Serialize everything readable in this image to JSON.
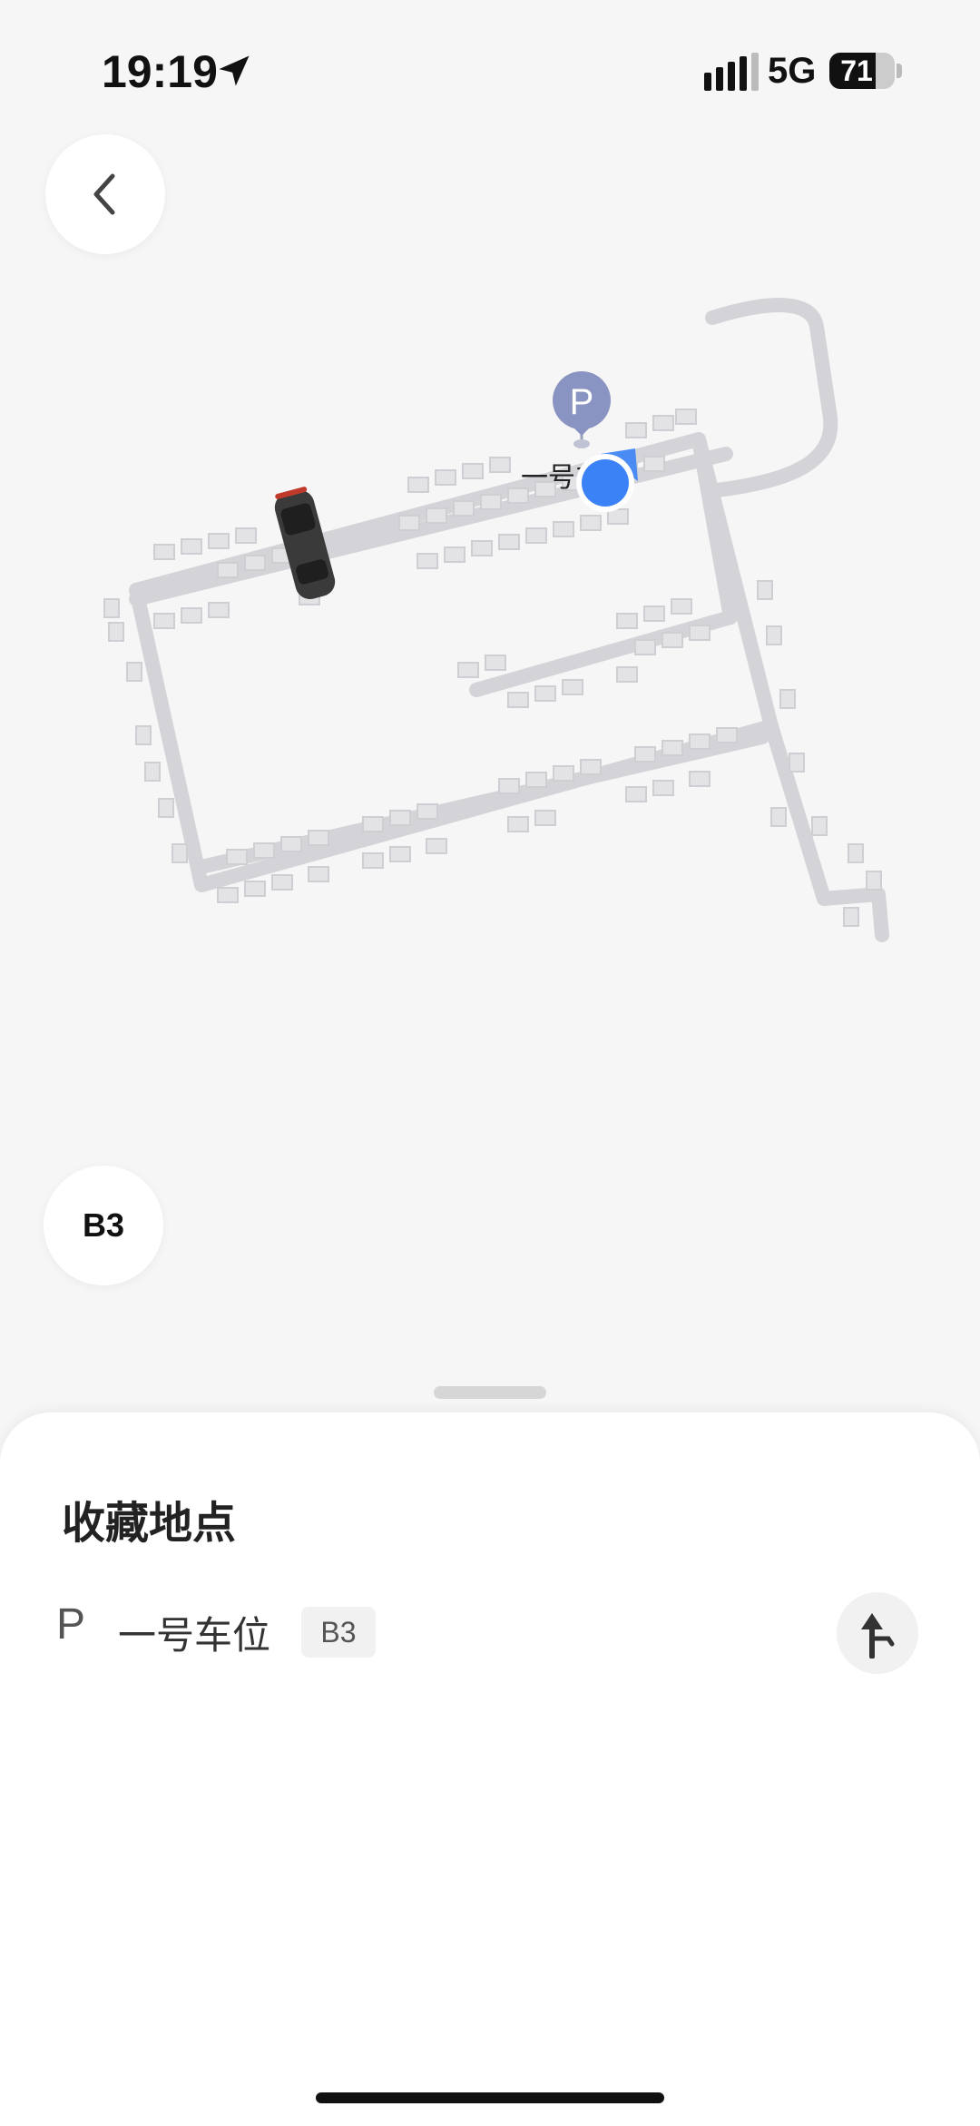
{
  "status_bar": {
    "time": "19:19",
    "network": "5G",
    "battery": "71",
    "battery_level": 0.71
  },
  "map": {
    "parking_label": "一号车位",
    "parking_marker_letter": "P",
    "icons": [
      "car-icon",
      "location-dot-icon",
      "parking-pin-icon"
    ]
  },
  "controls": {
    "back_icon": "chevron-left-icon",
    "floor_label": "B3"
  },
  "sheet": {
    "title": "收藏地点",
    "favorites": [
      {
        "icon_letter": "P",
        "name": "一号车位",
        "floor": "B3",
        "action_icon": "turn-navigation-icon"
      }
    ]
  },
  "colors": {
    "accent_blue": "#3b82f6",
    "marker_purple": "#8a94c2",
    "road_gray": "#d4d4d8"
  }
}
